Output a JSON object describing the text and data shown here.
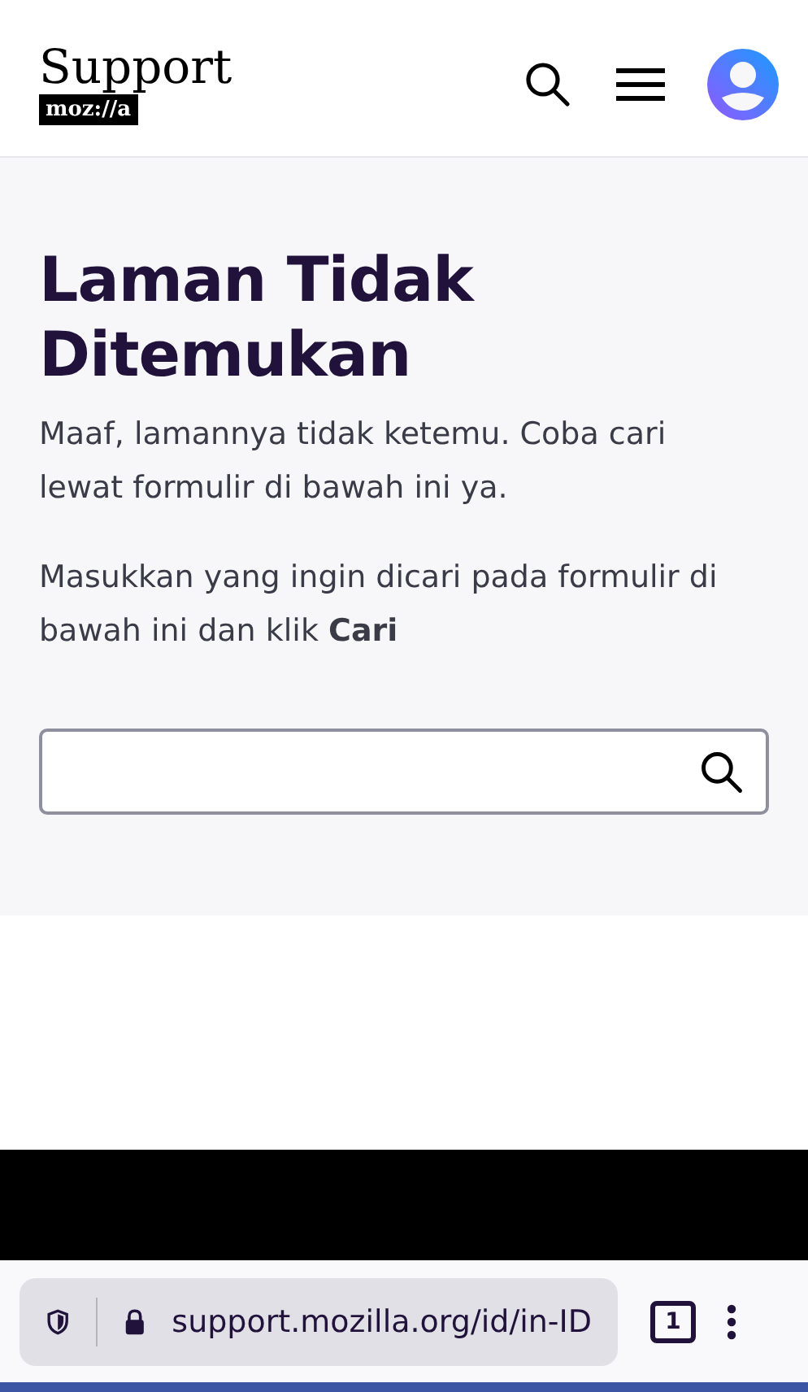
{
  "header": {
    "logo_title": "Support",
    "logo_badge": "moz://a"
  },
  "main": {
    "heading": "Laman Tidak Ditemukan",
    "paragraphs": [
      "Maaf, lamannya tidak ketemu. Coba cari lewat formulir di bawah ini ya.",
      "Masukkan yang ingin dicari pada formulir di bawah ini dan klik **Cari**"
    ]
  },
  "browser_bar": {
    "url": "support.mozilla.org/id/in-ID",
    "tab_count": "1"
  }
}
